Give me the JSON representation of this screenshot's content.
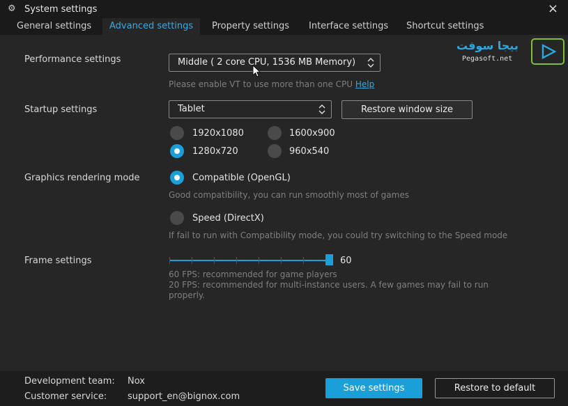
{
  "window": {
    "title": "System settings",
    "close_symbol": "×"
  },
  "tabs": [
    {
      "label": "General settings",
      "active": false
    },
    {
      "label": "Advanced settings",
      "active": true
    },
    {
      "label": "Property settings",
      "active": false
    },
    {
      "label": "Interface settings",
      "active": false
    },
    {
      "label": "Shortcut settings",
      "active": false
    }
  ],
  "performance": {
    "label": "Performance settings",
    "select_value": "Middle ( 2 core CPU, 1536 MB Memory)",
    "hint": "Please enable VT to use more than one CPU",
    "help_link": "Help"
  },
  "startup": {
    "label": "Startup settings",
    "select_value": "Tablet",
    "restore_button": "Restore window size",
    "resolutions": [
      {
        "label": "1920x1080",
        "checked": false
      },
      {
        "label": "1600x900",
        "checked": false
      },
      {
        "label": "1280x720",
        "checked": true
      },
      {
        "label": "960x540",
        "checked": false
      }
    ]
  },
  "graphics": {
    "label": "Graphics rendering mode",
    "compatible": {
      "label": "Compatible (OpenGL)",
      "checked": true,
      "hint": "Good compatibility, you can run smoothly most of games"
    },
    "speed": {
      "label": "Speed (DirectX)",
      "checked": false,
      "hint": " If fail to run with Compatibility mode, you could try switching to the Speed mode"
    }
  },
  "frame": {
    "label": "Frame settings",
    "value": "60",
    "hint_lines": [
      "60 FPS: recommended for game players",
      "20 FPS: recommended for multi-instance users. A few games may fail to run",
      "properly."
    ]
  },
  "footer": {
    "dev_label": "Development team:",
    "dev_value": "Nox",
    "support_label": "Customer service:",
    "support_value": "support_en@bignox.com",
    "save_button": "Save settings",
    "default_button": "Restore to default"
  },
  "watermark": {
    "text_ar": "بيجا سوفت",
    "url": "Pegasoft.net"
  },
  "colors": {
    "accent": "#1a9fd9",
    "background": "#262626",
    "titlebar": "#1a1a1a",
    "footer": "#1d1d1d",
    "watermark_green": "#7fbf3b"
  }
}
